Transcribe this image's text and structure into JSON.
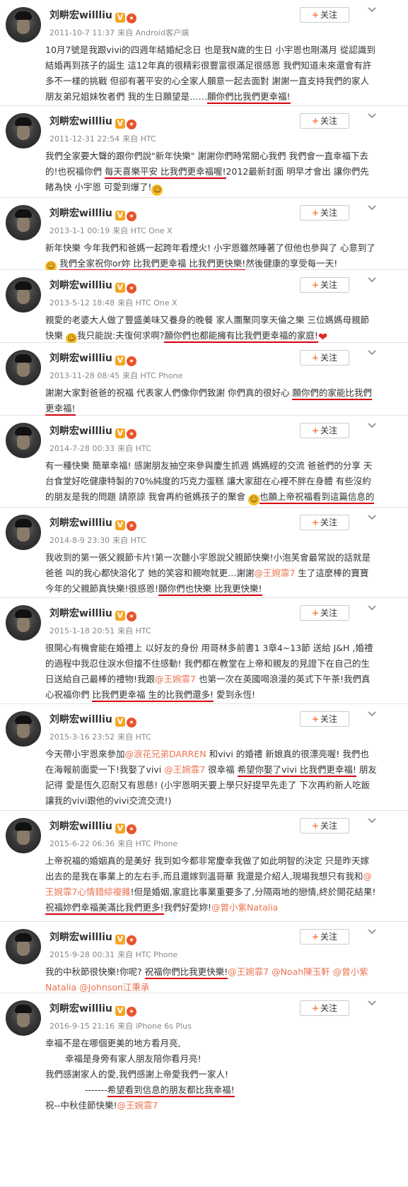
{
  "user": {
    "name": "刘畊宏willliu",
    "follow_label": "关注",
    "follow_plus": "+"
  },
  "colors": {
    "mention": "#eb7350",
    "highlight_underline": "#d8000f",
    "follow_plus": "#f77c3d"
  },
  "icons": {
    "verified": "verified-badge-icon",
    "medal": "medal-icon",
    "menu": "chevron-down-icon"
  },
  "posts": [
    {
      "time": "2011-10-7 11:37",
      "source": "来自 Android客户端",
      "parts": [
        {
          "t": "10月7號是我跟vivi的四週年結婚紀念日 也是我N歲的生日 小宇恩也剛滿月 從認識到結婚再到孩子的誕生 這12年真的很精彩很豐富很滿足很感恩 我們知道未來還會有許多不一樣的挑戰 但卻有著平安的心全家人願意一起去面對 謝謝一直支持我們的家人朋友弟兄姐妹牧者們 我的生日願望是……"
        },
        {
          "t": "願你們比我們更幸福!",
          "h": true
        }
      ]
    },
    {
      "time": "2011-12-31 22:54",
      "source": "来自 HTC",
      "parts": [
        {
          "t": "我們全家要大聲的跟你們說\"新年快樂\" 謝謝你們時常關心我們 我們會一直幸福下去的!也祝福你們 "
        },
        {
          "t": "每天喜樂平安 比我們更幸福喔!",
          "h": true
        },
        {
          "t": "2012最新封面 明早才會出 讓你們先睹為快 小宇恩 可愛到爆了!"
        },
        {
          "e": "face"
        }
      ]
    },
    {
      "time": "2013-1-1 00:19",
      "source": "来自 HTC One X",
      "parts": [
        {
          "t": "新年快樂 今年我們和爸媽一起跨年看煙火! 小宇恩雖然睡著了但他也參與了 心意到了"
        },
        {
          "e": "face"
        },
        {
          "t": " "
        },
        {
          "t": "我們全家祝你or妳 比我們更幸福 比我們更快樂!",
          "h": true
        },
        {
          "t": "然後健康的享受每一天!"
        }
      ]
    },
    {
      "time": "2013-5-12 18:48",
      "source": "来自 HTC One X",
      "parts": [
        {
          "t": "親愛的老婆大人做了豐盛美味又養身的晚餐 家人團聚同享天倫之樂 三位媽媽母親節快樂 "
        },
        {
          "e": "face"
        },
        {
          "t": "我只能說:夫復何求啊?"
        },
        {
          "t": "願你們也都能擁有比我們更幸福的家庭!",
          "h": true
        },
        {
          "e": "heart"
        }
      ]
    },
    {
      "time": "2013-11-28 08:45",
      "source": "来自 HTC Phone",
      "parts": [
        {
          "t": "謝謝大家對爸爸的祝福 代表家人們像你們致謝 你們真的很好心 "
        },
        {
          "t": "願你們的家能比我們更幸福!",
          "h": true
        }
      ]
    },
    {
      "time": "2014-7-28 00:33",
      "source": "来自 HTC",
      "parts": [
        {
          "t": "有一種快樂 簡單幸福! 感謝朋友抽空來參與慶生抓週 媽媽經的交流 爸爸們的分享 天台食堂好吃健康特製的70%純度的巧克力蛋糕 讓大家甜在心裡不胖在身體 有些沒約的朋友是我的問題 請原諒 我會再約爸媽孩子的聚會 "
        },
        {
          "e": "face"
        },
        {
          "t": "也願上帝祝福看到這篇信息的朋友 都能比我們還幸福!",
          "h": true
        },
        {
          "t": "@王婉霏7",
          "a": true
        }
      ]
    },
    {
      "time": "2014-8-9 23:30",
      "source": "来自 HTC",
      "parts": [
        {
          "t": "我收到的第一張父親節卡片!第一次聽小宇恩說父親節快樂!小泡芙會最常說的話就是 爸爸 叫的我心都快溶化了 她的笑容和親吻就更…謝謝"
        },
        {
          "t": "@王婉霏7",
          "a": true
        },
        {
          "t": " 生了這麼棒的寶寶 今年的父親節真快樂!很感恩!"
        },
        {
          "t": "願你們也快樂 比我更快樂!",
          "h": true
        }
      ]
    },
    {
      "time": "2015-1-18 20:51",
      "source": "来自 HTC",
      "parts": [
        {
          "t": "很開心有機會能在婚禮上 以好友的身份 用哥林多前書1 3章4~13節 送給 J&H ,婚禮的過程中我忍住淚水但擋不住感動! 我們都在教堂在上帝和親友的見證下在自己的生日送給自己最棒的禮物!我跟"
        },
        {
          "t": "@王婉霏7",
          "a": true
        },
        {
          "t": " 也第一次在英國喝浪漫的英式下午茶!我們真心祝福你們 "
        },
        {
          "t": "比我們更幸福 生的比我們還多!",
          "h": true
        },
        {
          "t": " 愛到永恆!"
        }
      ]
    },
    {
      "time": "2015-3-16 23:52",
      "source": "来自 HTC",
      "parts": [
        {
          "t": "今天帶小宇恩來參加"
        },
        {
          "t": "@浪花兄弟DARREN",
          "a": true
        },
        {
          "t": " 和vivi 的婚禮 新娘真的很漂亮喔! 我們也在海報前面愛一下!我娶了vivi "
        },
        {
          "t": "@王婉霏7",
          "a": true
        },
        {
          "t": " 很幸福 "
        },
        {
          "t": "希望你娶了vivi 比我們更幸福!",
          "h": true
        },
        {
          "t": " 朋友 記得 愛是恆久忍耐又有恩慈! (小宇恩明天要上學只好提早先走了 下次再約新人吃飯 讓我的vivi跟他的vivi交流交流!)"
        }
      ]
    },
    {
      "time": "2015-6-22 06:36",
      "source": "来自 HTC Phone",
      "parts": [
        {
          "t": "上帝祝福的婚姻真的是美好 我到如今都非常慶幸我做了如此明智的決定 只是昨天嫁出去的是我在事業上的左右手,而且還嫁到溫哥華 我還是介紹人,現場我想只有我和"
        },
        {
          "t": "@王婉霏7心情錯綜複雜",
          "a": true
        },
        {
          "t": "!但是婚姻,家庭比事業重要多了,分隔兩地的戀情,終於開花結果!"
        },
        {
          "t": "祝福妳們幸福美滿比我們更多!",
          "h": true
        },
        {
          "t": "我們好愛妳!"
        },
        {
          "t": "@曾小紫Natalia",
          "a": true
        }
      ]
    },
    {
      "time": "2015-9-28 00:31",
      "source": "来自 HTC Phone",
      "parts": [
        {
          "t": "我的中秋節很快樂!你呢? "
        },
        {
          "t": "祝福你們比我更快樂!",
          "h": true
        },
        {
          "t": "@王婉霏7",
          "a": true
        },
        {
          "t": " "
        },
        {
          "t": "@Noah陳玉軒",
          "a": true
        },
        {
          "t": " "
        },
        {
          "t": "@曾小紫Natalia",
          "a": true
        },
        {
          "t": " "
        },
        {
          "t": "@Johnson江秉承",
          "a": true
        }
      ]
    },
    {
      "time": "2016-9-15 21:16",
      "source": "来自 iPhone 6s Plus",
      "lines": [
        {
          "indent": 0,
          "parts": [
            {
              "t": "幸福不是在哪個更美的地方看月亮,"
            }
          ]
        },
        {
          "indent": 2,
          "parts": [
            {
              "t": "幸福是身旁有家人朋友陪你看月亮!"
            }
          ]
        },
        {
          "indent": 0,
          "parts": [
            {
              "t": "我們感謝家人的愛,我們感謝上帝愛我們一家人!"
            }
          ]
        },
        {
          "indent": 4,
          "parts": [
            {
              "t": "-------"
            },
            {
              "t": "希望看到信息的朋友都比我幸福!",
              "h": true
            }
          ]
        },
        {
          "indent": 0,
          "parts": [
            {
              "t": "祝--中秋佳節快樂!"
            },
            {
              "t": "@王婉霏7",
              "a": true
            }
          ]
        }
      ]
    }
  ]
}
